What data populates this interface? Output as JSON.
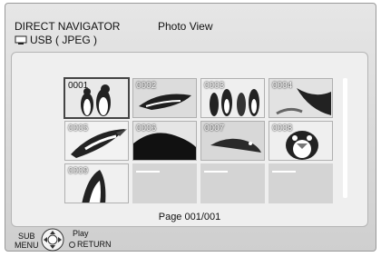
{
  "header": {
    "title": "DIRECT NAVIGATOR",
    "view": "Photo View",
    "source": "USB ( JPEG )",
    "source_icon": "usb-drive-icon"
  },
  "grid": {
    "selected": "0001",
    "items": [
      {
        "number": "0001",
        "image": "penguin-pair"
      },
      {
        "number": "0002",
        "image": "diving-penguin"
      },
      {
        "number": "0003",
        "image": "penguin-group"
      },
      {
        "number": "0004",
        "image": "penguin-swimming"
      },
      {
        "number": "0005",
        "image": "penguin-closeup"
      },
      {
        "number": "0006",
        "image": "penguin-on-ice"
      },
      {
        "number": "0007",
        "image": "penguin-underwater"
      },
      {
        "number": "0008",
        "image": "penguin-face"
      },
      {
        "number": "0009",
        "image": "penguin-walking"
      },
      {
        "number": "",
        "image": null
      },
      {
        "number": "",
        "image": null
      },
      {
        "number": "",
        "image": null
      }
    ]
  },
  "pager": {
    "label": "Page 001/001"
  },
  "footer": {
    "sub_menu_line1": "SUB",
    "sub_menu_line2": "MENU",
    "play": "Play",
    "return": "RETURN"
  }
}
